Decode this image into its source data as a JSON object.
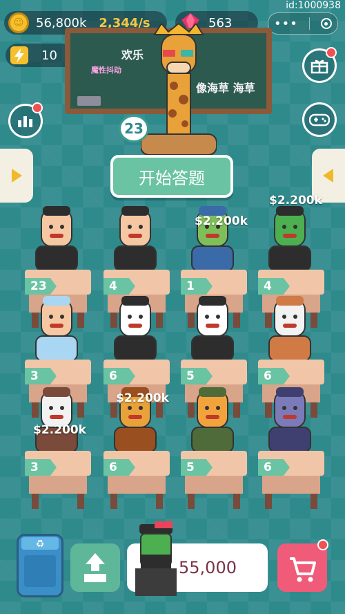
{
  "topbar": {
    "coins": "56,800k",
    "rate": "2,344/s",
    "gems": "563",
    "energy": "10",
    "user_id": "id:1000938"
  },
  "chalkboard": {
    "line1": "欢乐",
    "line2": "魔性抖动",
    "line3": "像海草 海草"
  },
  "teacher_level": "23",
  "start_button": "开始答题",
  "income_labels": [
    "$2.200k",
    "$2.200k",
    "$2.200k",
    "$2.200k"
  ],
  "desks": [
    {
      "level": "23",
      "character": "curly-hair-man"
    },
    {
      "level": "4",
      "character": "bowler-hat-man"
    },
    {
      "level": "1",
      "character": "frog"
    },
    {
      "level": "4",
      "character": "green-ogre-cap"
    },
    {
      "level": "3",
      "character": "grandma"
    },
    {
      "level": "6",
      "character": "penguin"
    },
    {
      "level": "5",
      "character": "dog-white"
    },
    {
      "level": "6",
      "character": "dog-brown"
    },
    {
      "level": "3",
      "character": "raccoon"
    },
    {
      "level": "6",
      "character": "giraffe"
    },
    {
      "level": "5",
      "character": "cat-soldier"
    },
    {
      "level": "6",
      "character": "buffalo"
    }
  ],
  "buy_price": "55,000",
  "colors": {
    "background": "#2f8a8c",
    "accent": "#6ac3a2",
    "desk_top": "#f1c6a8",
    "cart": "#ef5b78"
  }
}
